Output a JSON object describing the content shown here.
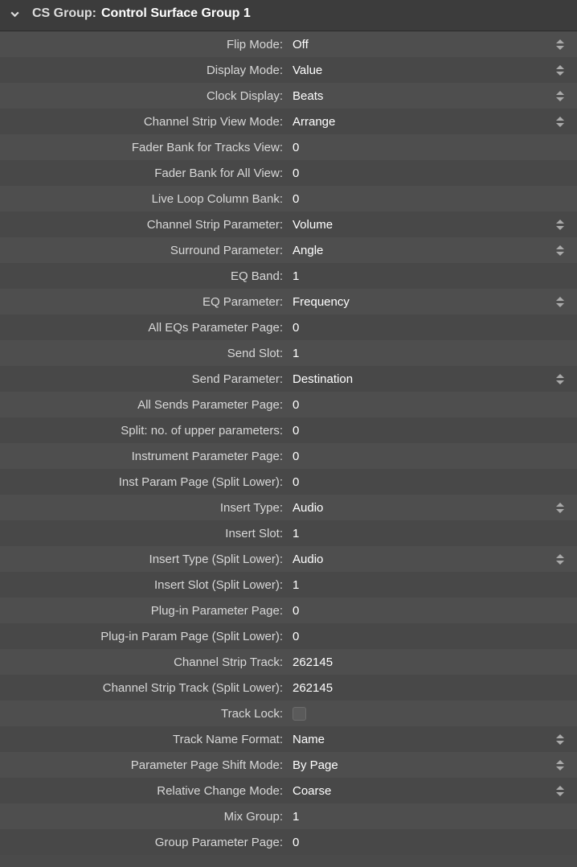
{
  "header": {
    "label": "CS Group:",
    "value": "Control Surface Group 1"
  },
  "rows": [
    {
      "label": "Flip Mode:",
      "value": "Off",
      "stepper": true,
      "type": "text"
    },
    {
      "label": "Display Mode:",
      "value": "Value",
      "stepper": true,
      "type": "text"
    },
    {
      "label": "Clock Display:",
      "value": "Beats",
      "stepper": true,
      "type": "text"
    },
    {
      "label": "Channel Strip View Mode:",
      "value": "Arrange",
      "stepper": true,
      "type": "text"
    },
    {
      "label": "Fader Bank for Tracks View:",
      "value": "0",
      "stepper": false,
      "type": "text"
    },
    {
      "label": "Fader Bank for All View:",
      "value": "0",
      "stepper": false,
      "type": "text"
    },
    {
      "label": "Live Loop Column Bank:",
      "value": "0",
      "stepper": false,
      "type": "text"
    },
    {
      "label": "Channel Strip Parameter:",
      "value": "Volume",
      "stepper": true,
      "type": "text"
    },
    {
      "label": "Surround Parameter:",
      "value": "Angle",
      "stepper": true,
      "type": "text"
    },
    {
      "label": "EQ Band:",
      "value": "1",
      "stepper": false,
      "type": "text"
    },
    {
      "label": "EQ Parameter:",
      "value": "Frequency",
      "stepper": true,
      "type": "text"
    },
    {
      "label": "All EQs Parameter Page:",
      "value": "0",
      "stepper": false,
      "type": "text"
    },
    {
      "label": "Send Slot:",
      "value": "1",
      "stepper": false,
      "type": "text"
    },
    {
      "label": "Send Parameter:",
      "value": "Destination",
      "stepper": true,
      "type": "text"
    },
    {
      "label": "All Sends Parameter Page:",
      "value": "0",
      "stepper": false,
      "type": "text"
    },
    {
      "label": "Split: no. of upper parameters:",
      "value": "0",
      "stepper": false,
      "type": "text"
    },
    {
      "label": "Instrument Parameter Page:",
      "value": "0",
      "stepper": false,
      "type": "text"
    },
    {
      "label": "Inst Param Page (Split Lower):",
      "value": "0",
      "stepper": false,
      "type": "text"
    },
    {
      "label": "Insert Type:",
      "value": "Audio",
      "stepper": true,
      "type": "text"
    },
    {
      "label": "Insert Slot:",
      "value": "1",
      "stepper": false,
      "type": "text"
    },
    {
      "label": "Insert Type (Split Lower):",
      "value": "Audio",
      "stepper": true,
      "type": "text"
    },
    {
      "label": "Insert Slot (Split Lower):",
      "value": "1",
      "stepper": false,
      "type": "text"
    },
    {
      "label": "Plug-in Parameter Page:",
      "value": "0",
      "stepper": false,
      "type": "text"
    },
    {
      "label": "Plug-in Param Page (Split Lower):",
      "value": "0",
      "stepper": false,
      "type": "text"
    },
    {
      "label": "Channel Strip Track:",
      "value": "262145",
      "stepper": false,
      "type": "text"
    },
    {
      "label": "Channel Strip Track (Split Lower):",
      "value": "262145",
      "stepper": false,
      "type": "text"
    },
    {
      "label": "Track Lock:",
      "value": "",
      "stepper": false,
      "type": "checkbox"
    },
    {
      "label": "Track Name Format:",
      "value": "Name",
      "stepper": true,
      "type": "text"
    },
    {
      "label": "Parameter Page Shift Mode:",
      "value": "By Page",
      "stepper": true,
      "type": "text"
    },
    {
      "label": "Relative Change Mode:",
      "value": "Coarse",
      "stepper": true,
      "type": "text"
    },
    {
      "label": "Mix Group:",
      "value": "1",
      "stepper": false,
      "type": "text"
    },
    {
      "label": "Group Parameter Page:",
      "value": "0",
      "stepper": false,
      "type": "text"
    }
  ]
}
